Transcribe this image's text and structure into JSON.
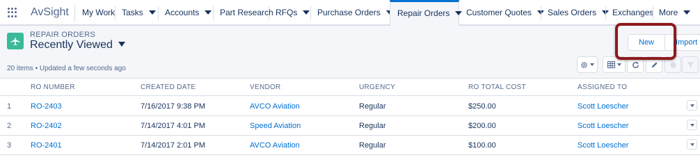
{
  "nav": {
    "app_name": "AvSight",
    "tabs": [
      {
        "label": "My Work"
      },
      {
        "label": "Tasks"
      },
      {
        "label": "Accounts"
      },
      {
        "label": "Part Research"
      },
      {
        "label": "RFQs"
      },
      {
        "label": "Purchase Orders"
      },
      {
        "label": "Repair Orders"
      },
      {
        "label": "Customer Quotes"
      },
      {
        "label": "Sales Orders"
      },
      {
        "label": "Exchanges"
      },
      {
        "label": "More"
      }
    ],
    "active_tab": "Repair Orders"
  },
  "header": {
    "object_label": "REPAIR ORDERS",
    "list_view": "Recently Viewed",
    "status": "20 items • Updated a few seconds ago",
    "icon": "airplane-icon",
    "buttons": {
      "new": "New",
      "import": "Import"
    }
  },
  "toolbar": {
    "icons": [
      "gear-icon",
      "table-icon",
      "refresh-icon",
      "pencil-icon",
      "chart-icon",
      "filter-icon"
    ]
  },
  "table": {
    "columns": [
      "RO NUMBER",
      "CREATED DATE",
      "VENDOR",
      "URGENCY",
      "RO TOTAL COST",
      "ASSIGNED TO"
    ],
    "rows": [
      {
        "num": "1",
        "ro": "RO-2403",
        "date": "7/16/2017 9:38 PM",
        "vendor": "AVCO Aviation",
        "urgency": "Regular",
        "cost": "$250.00",
        "assigned": "Scott Loescher"
      },
      {
        "num": "2",
        "ro": "RO-2402",
        "date": "7/14/2017 4:01 PM",
        "vendor": "Speed Aviation",
        "urgency": "Regular",
        "cost": "$200.00",
        "assigned": "Scott Loescher"
      },
      {
        "num": "3",
        "ro": "RO-2401",
        "date": "7/14/2017 2:01 PM",
        "vendor": "AVCO Aviation",
        "urgency": "Regular",
        "cost": "$100.00",
        "assigned": "Scott Loescher"
      }
    ]
  },
  "colors": {
    "brand": "#0070d2",
    "object_icon": "#3bba9a",
    "highlight": "#8f1a1c"
  }
}
